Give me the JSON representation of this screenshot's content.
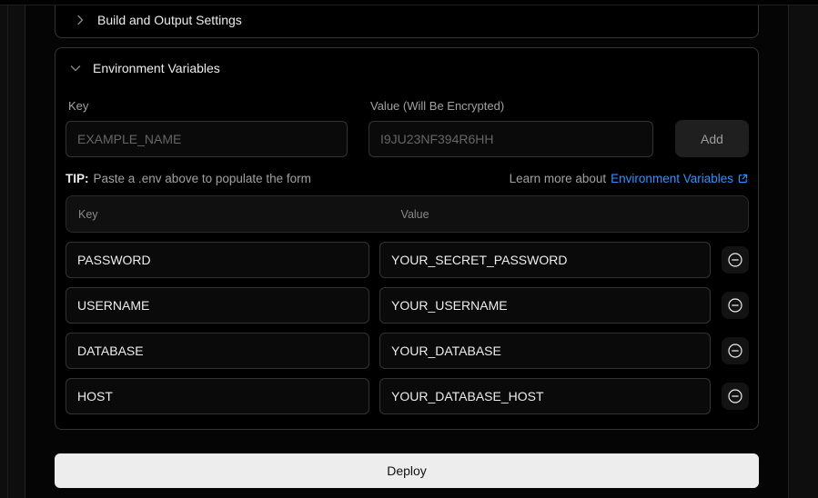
{
  "colors": {
    "accent_blue": "#3291ff",
    "card_border": "#333333",
    "deploy_bg": "#ededed",
    "page_bg": "#050505"
  },
  "sections": {
    "build_output": {
      "label": "Build and Output Settings",
      "state": "collapsed"
    },
    "env_vars": {
      "label": "Environment Variables",
      "state": "expanded"
    }
  },
  "form": {
    "key_label": "Key",
    "key_placeholder": "EXAMPLE_NAME",
    "value_label": "Value (Will Be Encrypted)",
    "value_placeholder": "I9JU23NF394R6HH",
    "add_label": "Add",
    "tip_prefix": "TIP:",
    "tip_text": "Paste a .env above to populate the form",
    "learn_more_text": "Learn more about",
    "learn_more_link": "Environment Variables"
  },
  "table": {
    "headers": {
      "key": "Key",
      "value": "Value"
    },
    "rows": [
      {
        "key": "PASSWORD",
        "value": "YOUR_SECRET_PASSWORD"
      },
      {
        "key": "USERNAME",
        "value": "YOUR_USERNAME"
      },
      {
        "key": "DATABASE",
        "value": "YOUR_DATABASE"
      },
      {
        "key": "HOST",
        "value": "YOUR_DATABASE_HOST"
      }
    ]
  },
  "deploy": {
    "label": "Deploy"
  }
}
